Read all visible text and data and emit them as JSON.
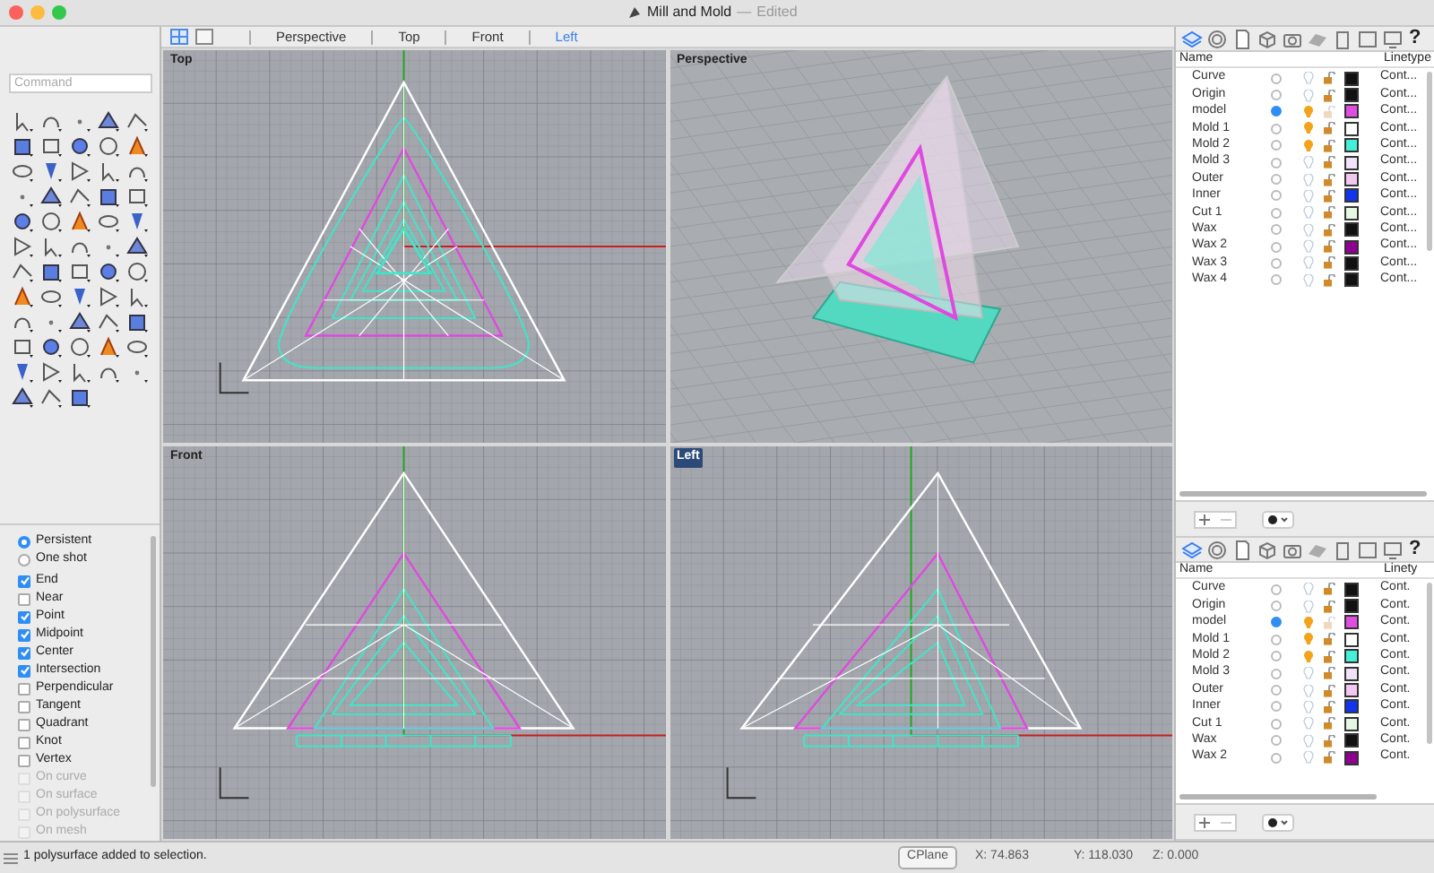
{
  "window": {
    "title": "Mill and Mold",
    "separator": "—",
    "state": "Edited"
  },
  "view_tabs": [
    {
      "label": "Perspective",
      "selected": false
    },
    {
      "label": "Top",
      "selected": false
    },
    {
      "label": "Front",
      "selected": false
    },
    {
      "label": "Left",
      "selected": true
    }
  ],
  "command": {
    "placeholder": "Command"
  },
  "osnap": {
    "modes": [
      {
        "label": "Persistent",
        "selected": true
      },
      {
        "label": "One shot",
        "selected": false
      }
    ],
    "snaps": [
      {
        "label": "End",
        "checked": true,
        "disabled": false
      },
      {
        "label": "Near",
        "checked": false,
        "disabled": false
      },
      {
        "label": "Point",
        "checked": true,
        "disabled": false
      },
      {
        "label": "Midpoint",
        "checked": true,
        "disabled": false
      },
      {
        "label": "Center",
        "checked": true,
        "disabled": false
      },
      {
        "label": "Intersection",
        "checked": true,
        "disabled": false
      },
      {
        "label": "Perpendicular",
        "checked": false,
        "disabled": false
      },
      {
        "label": "Tangent",
        "checked": false,
        "disabled": false
      },
      {
        "label": "Quadrant",
        "checked": false,
        "disabled": false
      },
      {
        "label": "Knot",
        "checked": false,
        "disabled": false
      },
      {
        "label": "Vertex",
        "checked": false,
        "disabled": false
      },
      {
        "label": "On curve",
        "checked": false,
        "disabled": true
      },
      {
        "label": "On surface",
        "checked": false,
        "disabled": true
      },
      {
        "label": "On polysurface",
        "checked": false,
        "disabled": true
      },
      {
        "label": "On mesh",
        "checked": false,
        "disabled": true
      }
    ]
  },
  "viewports": [
    {
      "label": "Top",
      "kind": "top",
      "active": false
    },
    {
      "label": "Perspective",
      "kind": "perspective",
      "active": false
    },
    {
      "label": "Front",
      "kind": "front",
      "active": false
    },
    {
      "label": "Left",
      "kind": "left",
      "active": true
    }
  ],
  "layer_panels": [
    {
      "help": "?",
      "columns": [
        "Name",
        "Linetype"
      ],
      "rows": [
        {
          "name": "Curve",
          "current": false,
          "on": false,
          "lock_dimmed": false,
          "color": "#111111",
          "linetype": "Cont..."
        },
        {
          "name": "Origin",
          "current": false,
          "on": false,
          "lock_dimmed": false,
          "color": "#111111",
          "linetype": "Cont..."
        },
        {
          "name": "model",
          "current": true,
          "on": true,
          "lock_dimmed": true,
          "color": "#e04ee0",
          "linetype": "Cont..."
        },
        {
          "name": "Mold 1",
          "current": false,
          "on": true,
          "lock_dimmed": false,
          "color": "#ffffff",
          "linetype": "Cont..."
        },
        {
          "name": "Mold 2",
          "current": false,
          "on": true,
          "lock_dimmed": false,
          "color": "#44f0d8",
          "linetype": "Cont..."
        },
        {
          "name": "Mold 3",
          "current": false,
          "on": false,
          "lock_dimmed": false,
          "color": "#f0e2f8",
          "linetype": "Cont..."
        },
        {
          "name": "Outer",
          "current": false,
          "on": false,
          "lock_dimmed": false,
          "color": "#f2c8f2",
          "linetype": "Cont..."
        },
        {
          "name": "Inner",
          "current": false,
          "on": false,
          "lock_dimmed": false,
          "color": "#1034f0",
          "linetype": "Cont..."
        },
        {
          "name": "Cut 1",
          "current": false,
          "on": false,
          "lock_dimmed": false,
          "color": "#e2f8e0",
          "linetype": "Cont..."
        },
        {
          "name": "Wax",
          "current": false,
          "on": false,
          "lock_dimmed": false,
          "color": "#111111",
          "linetype": "Cont..."
        },
        {
          "name": "Wax 2",
          "current": false,
          "on": false,
          "lock_dimmed": false,
          "color": "#900090",
          "linetype": "Cont..."
        },
        {
          "name": "Wax 3",
          "current": false,
          "on": false,
          "lock_dimmed": false,
          "color": "#111111",
          "linetype": "Cont..."
        },
        {
          "name": "Wax 4",
          "current": false,
          "on": false,
          "lock_dimmed": false,
          "color": "#111111",
          "linetype": "Cont..."
        }
      ]
    },
    {
      "help": "?",
      "columns": [
        "Name",
        "Linety"
      ],
      "rows": [
        {
          "name": "Curve",
          "current": false,
          "on": false,
          "lock_dimmed": false,
          "color": "#111111",
          "linetype": "Cont."
        },
        {
          "name": "Origin",
          "current": false,
          "on": false,
          "lock_dimmed": false,
          "color": "#111111",
          "linetype": "Cont."
        },
        {
          "name": "model",
          "current": true,
          "on": true,
          "lock_dimmed": true,
          "color": "#e04ee0",
          "linetype": "Cont."
        },
        {
          "name": "Mold 1",
          "current": false,
          "on": true,
          "lock_dimmed": false,
          "color": "#ffffff",
          "linetype": "Cont."
        },
        {
          "name": "Mold 2",
          "current": false,
          "on": true,
          "lock_dimmed": false,
          "color": "#44f0d8",
          "linetype": "Cont."
        },
        {
          "name": "Mold 3",
          "current": false,
          "on": false,
          "lock_dimmed": false,
          "color": "#f0e2f8",
          "linetype": "Cont."
        },
        {
          "name": "Outer",
          "current": false,
          "on": false,
          "lock_dimmed": false,
          "color": "#f2c8f2",
          "linetype": "Cont."
        },
        {
          "name": "Inner",
          "current": false,
          "on": false,
          "lock_dimmed": false,
          "color": "#1034f0",
          "linetype": "Cont."
        },
        {
          "name": "Cut 1",
          "current": false,
          "on": false,
          "lock_dimmed": false,
          "color": "#e2f8e0",
          "linetype": "Cont."
        },
        {
          "name": "Wax",
          "current": false,
          "on": false,
          "lock_dimmed": false,
          "color": "#111111",
          "linetype": "Cont."
        },
        {
          "name": "Wax 2",
          "current": false,
          "on": false,
          "lock_dimmed": false,
          "color": "#900090",
          "linetype": "Cont."
        }
      ]
    }
  ],
  "status_bar": {
    "message": "1 polysurface added to selection.",
    "cplane": "CPlane",
    "x": "X: 74.863",
    "y": "Y: 118.030",
    "z": "Z: 0.000"
  }
}
